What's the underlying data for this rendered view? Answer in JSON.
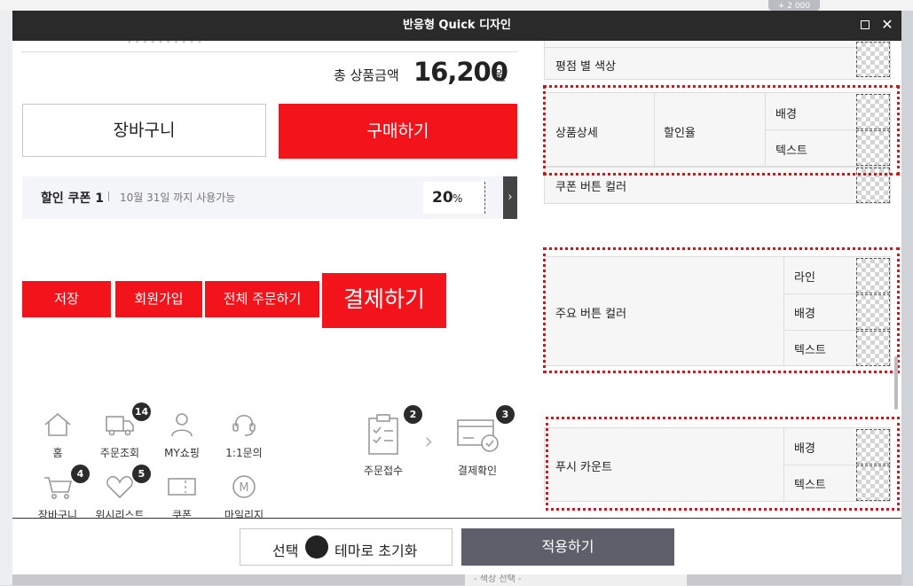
{
  "background": {
    "badge": "+ 2 000",
    "select_placeholder": "- 색상 선택 -"
  },
  "window": {
    "title": "반응형 Quick 디자인",
    "maximize": "maximize-icon",
    "close": "close-icon"
  },
  "preview": {
    "dash_top": "- - - - - - - - - -",
    "total_label": "총 상품금액",
    "total_amount": "16,200",
    "total_unit": "원",
    "cart_button": "장바구니",
    "buy_button": "구매하기",
    "coupon": {
      "name": "할인 쿠폰 1",
      "date": "10월 31일 까지 사용가능",
      "percent": "20",
      "percent_sign": "%"
    },
    "red_buttons": {
      "save": "저장",
      "join": "회원가입",
      "order_all": "전체 주문하기",
      "pay": "결제하기"
    },
    "quick_icons": [
      {
        "label": "홈",
        "icon": "home-icon",
        "badge": ""
      },
      {
        "label": "주문조회",
        "icon": "truck-icon",
        "badge": "14"
      },
      {
        "label": "MY쇼핑",
        "icon": "person-icon",
        "badge": ""
      },
      {
        "label": "1:1문의",
        "icon": "headset-icon",
        "badge": ""
      },
      {
        "label": "장바구니",
        "icon": "cart-icon",
        "badge": "4"
      },
      {
        "label": "위시리스트",
        "icon": "heart-icon",
        "badge": "5"
      },
      {
        "label": "쿠폰",
        "icon": "ticket-icon",
        "badge": ""
      },
      {
        "label": "마일리지",
        "icon": "mileage-icon",
        "badge": ""
      }
    ],
    "steps": [
      {
        "label": "주문접수",
        "icon": "clipboard-icon",
        "badge": "2"
      },
      {
        "label": "결제확인",
        "icon": "card-check-icon",
        "badge": "3"
      }
    ]
  },
  "settings": {
    "rating_color": "평점 별 색상",
    "product_detail": {
      "label": "상품상세",
      "sub": "할인율",
      "rows": [
        "배경",
        "텍스트"
      ]
    },
    "coupon_button_color": "쿠폰 버튼 컬러",
    "main_button_color": {
      "label": "주요 버튼 컬러",
      "rows": [
        "라인",
        "배경",
        "텍스트"
      ]
    },
    "push_count": {
      "label": "푸시 카운트",
      "rows": [
        "배경",
        "텍스트"
      ]
    }
  },
  "footer": {
    "reset_prefix": "선택",
    "reset_suffix": "테마로 초기화",
    "apply": "적용하기"
  },
  "colors": {
    "accent": "#f3141b",
    "titlebar": "#2a2a2a",
    "apply": "#5d606b",
    "highlight": "#d0141b"
  }
}
